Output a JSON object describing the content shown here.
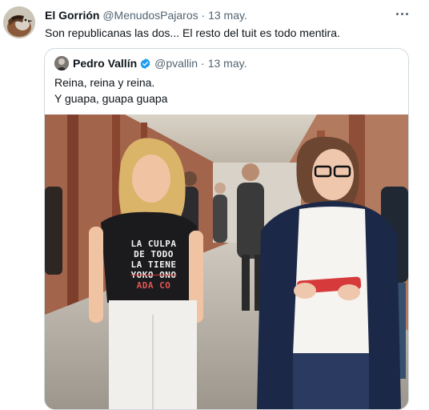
{
  "tweet": {
    "author_name": "El Gorrión",
    "author_handle": "@MenudosPajaros",
    "separator": "·",
    "date": "13 may.",
    "text": "Son republicanas las dos... El resto del tuit es todo mentira.",
    "avatar_icon": "sparrow-avatar",
    "more_icon": "more-options-icon"
  },
  "quoted": {
    "author_name": "Pedro Vallín",
    "verified_icon": "verified-badge-icon",
    "author_handle": "@pvallin",
    "separator": "·",
    "date": "13 may.",
    "text_line1": "Reina, reina y reina.",
    "text_line2": "Y guapa, guapa guapa",
    "shirt_lines": [
      "LA CULPA",
      "DE TODO",
      "LA TIENE",
      "YOKO ONO",
      "ADA CO"
    ]
  },
  "colors": {
    "verified": "#1d9bf0",
    "border": "#cfd9de",
    "muted": "#536471",
    "text": "#0f1419"
  }
}
